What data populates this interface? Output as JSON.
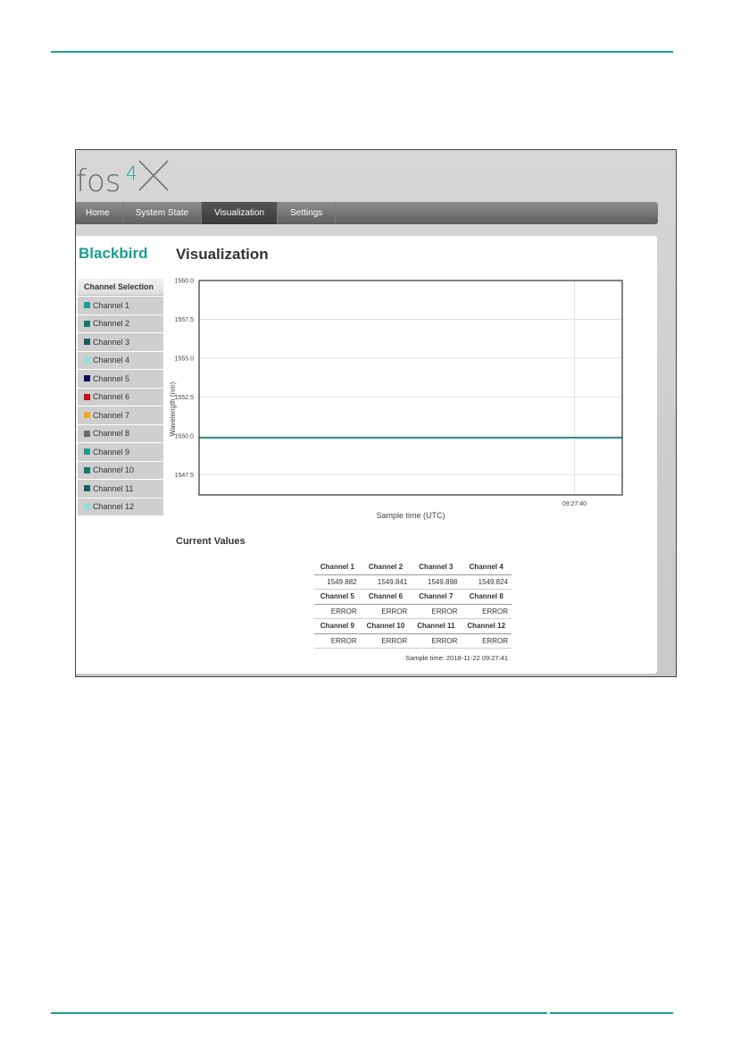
{
  "app": {
    "logo_text": "fos",
    "logo_mark": "4X",
    "nav": [
      {
        "label": "Home"
      },
      {
        "label": "System State"
      },
      {
        "label": "Visualization",
        "active": true
      },
      {
        "label": "Settings"
      }
    ],
    "device_name": "Blackbird",
    "page_title": "Visualization"
  },
  "colors": {
    "accent": "#1b9e97",
    "rule": "#1b9e97"
  },
  "channel_panel": {
    "header": "Channel Selection",
    "items": [
      {
        "label": "Channel 1",
        "color": "#1b9e97"
      },
      {
        "label": "Channel 2",
        "color": "#137a6b"
      },
      {
        "label": "Channel 3",
        "color": "#1e5b5e"
      },
      {
        "label": "Channel 4",
        "color": "#8fe0d8"
      },
      {
        "label": "Channel 5",
        "color": "#0d0d5c"
      },
      {
        "label": "Channel 6",
        "color": "#c0101c"
      },
      {
        "label": "Channel 7",
        "color": "#f0a820"
      },
      {
        "label": "Channel 8",
        "color": "#6a6a6a"
      },
      {
        "label": "Channel 9",
        "color": "#1b9e97"
      },
      {
        "label": "Channel 10",
        "color": "#137a6b"
      },
      {
        "label": "Channel 11",
        "color": "#1e5b5e"
      },
      {
        "label": "Channel 12",
        "color": "#8fe0d8"
      }
    ]
  },
  "chart_data": {
    "type": "line",
    "xlabel": "Sample time (UTC)",
    "ylabel": "Wavelength (nm)",
    "ylim": [
      1546.2,
      1560.0
    ],
    "yticks": [
      "1560.0",
      "1557.5",
      "1555.0",
      "1552.5",
      "1550.0",
      "1547.5"
    ],
    "ytick_values": [
      1560.0,
      1557.5,
      1555.0,
      1552.5,
      1550.0,
      1547.5
    ],
    "xticks": [
      "09:27:40"
    ],
    "grid": true,
    "series": [
      {
        "color": "#1b9e97",
        "y": 1549.882
      },
      {
        "color": "#137a6b",
        "y": 1549.841
      },
      {
        "color": "#1e5b5e",
        "y": 1549.898
      },
      {
        "color": "#8fe0d8",
        "y": 1549.824
      }
    ]
  },
  "current_values": {
    "title": "Current Values",
    "rows": [
      {
        "headers": [
          "Channel 1",
          "Channel 2",
          "Channel 3",
          "Channel 4"
        ],
        "values": [
          "1549.882",
          "1549.841",
          "1549.898",
          "1549.824"
        ]
      },
      {
        "headers": [
          "Channel 5",
          "Channel 6",
          "Channel 7",
          "Channel 8"
        ],
        "values": [
          "ERROR",
          "ERROR",
          "ERROR",
          "ERROR"
        ]
      },
      {
        "headers": [
          "Channel 9",
          "Channel 10",
          "Channel 11",
          "Channel 12"
        ],
        "values": [
          "ERROR",
          "ERROR",
          "ERROR",
          "ERROR"
        ]
      }
    ],
    "sample_time": "Sample time: 2018-11-22 09:27:41"
  }
}
